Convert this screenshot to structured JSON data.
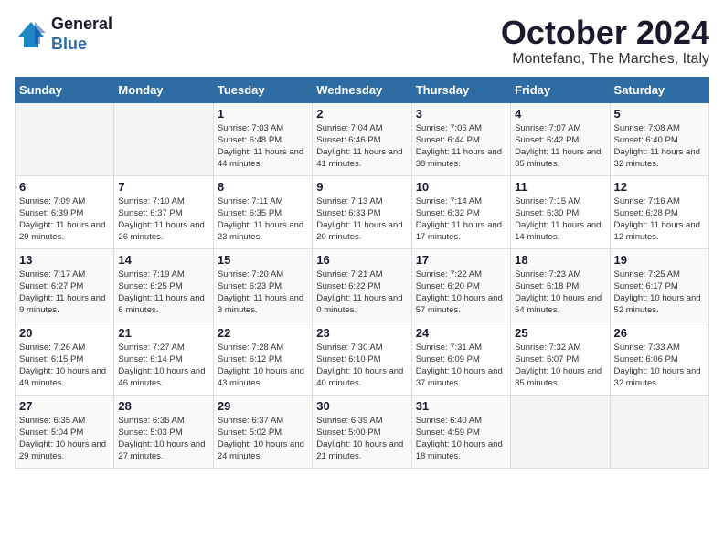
{
  "header": {
    "logo_line1": "General",
    "logo_line2": "Blue",
    "title": "October 2024",
    "subtitle": "Montefano, The Marches, Italy"
  },
  "weekdays": [
    "Sunday",
    "Monday",
    "Tuesday",
    "Wednesday",
    "Thursday",
    "Friday",
    "Saturday"
  ],
  "weeks": [
    [
      {
        "day": "",
        "info": ""
      },
      {
        "day": "",
        "info": ""
      },
      {
        "day": "1",
        "info": "Sunrise: 7:03 AM\nSunset: 6:48 PM\nDaylight: 11 hours and 44 minutes."
      },
      {
        "day": "2",
        "info": "Sunrise: 7:04 AM\nSunset: 6:46 PM\nDaylight: 11 hours and 41 minutes."
      },
      {
        "day": "3",
        "info": "Sunrise: 7:06 AM\nSunset: 6:44 PM\nDaylight: 11 hours and 38 minutes."
      },
      {
        "day": "4",
        "info": "Sunrise: 7:07 AM\nSunset: 6:42 PM\nDaylight: 11 hours and 35 minutes."
      },
      {
        "day": "5",
        "info": "Sunrise: 7:08 AM\nSunset: 6:40 PM\nDaylight: 11 hours and 32 minutes."
      }
    ],
    [
      {
        "day": "6",
        "info": "Sunrise: 7:09 AM\nSunset: 6:39 PM\nDaylight: 11 hours and 29 minutes."
      },
      {
        "day": "7",
        "info": "Sunrise: 7:10 AM\nSunset: 6:37 PM\nDaylight: 11 hours and 26 minutes."
      },
      {
        "day": "8",
        "info": "Sunrise: 7:11 AM\nSunset: 6:35 PM\nDaylight: 11 hours and 23 minutes."
      },
      {
        "day": "9",
        "info": "Sunrise: 7:13 AM\nSunset: 6:33 PM\nDaylight: 11 hours and 20 minutes."
      },
      {
        "day": "10",
        "info": "Sunrise: 7:14 AM\nSunset: 6:32 PM\nDaylight: 11 hours and 17 minutes."
      },
      {
        "day": "11",
        "info": "Sunrise: 7:15 AM\nSunset: 6:30 PM\nDaylight: 11 hours and 14 minutes."
      },
      {
        "day": "12",
        "info": "Sunrise: 7:16 AM\nSunset: 6:28 PM\nDaylight: 11 hours and 12 minutes."
      }
    ],
    [
      {
        "day": "13",
        "info": "Sunrise: 7:17 AM\nSunset: 6:27 PM\nDaylight: 11 hours and 9 minutes."
      },
      {
        "day": "14",
        "info": "Sunrise: 7:19 AM\nSunset: 6:25 PM\nDaylight: 11 hours and 6 minutes."
      },
      {
        "day": "15",
        "info": "Sunrise: 7:20 AM\nSunset: 6:23 PM\nDaylight: 11 hours and 3 minutes."
      },
      {
        "day": "16",
        "info": "Sunrise: 7:21 AM\nSunset: 6:22 PM\nDaylight: 11 hours and 0 minutes."
      },
      {
        "day": "17",
        "info": "Sunrise: 7:22 AM\nSunset: 6:20 PM\nDaylight: 10 hours and 57 minutes."
      },
      {
        "day": "18",
        "info": "Sunrise: 7:23 AM\nSunset: 6:18 PM\nDaylight: 10 hours and 54 minutes."
      },
      {
        "day": "19",
        "info": "Sunrise: 7:25 AM\nSunset: 6:17 PM\nDaylight: 10 hours and 52 minutes."
      }
    ],
    [
      {
        "day": "20",
        "info": "Sunrise: 7:26 AM\nSunset: 6:15 PM\nDaylight: 10 hours and 49 minutes."
      },
      {
        "day": "21",
        "info": "Sunrise: 7:27 AM\nSunset: 6:14 PM\nDaylight: 10 hours and 46 minutes."
      },
      {
        "day": "22",
        "info": "Sunrise: 7:28 AM\nSunset: 6:12 PM\nDaylight: 10 hours and 43 minutes."
      },
      {
        "day": "23",
        "info": "Sunrise: 7:30 AM\nSunset: 6:10 PM\nDaylight: 10 hours and 40 minutes."
      },
      {
        "day": "24",
        "info": "Sunrise: 7:31 AM\nSunset: 6:09 PM\nDaylight: 10 hours and 37 minutes."
      },
      {
        "day": "25",
        "info": "Sunrise: 7:32 AM\nSunset: 6:07 PM\nDaylight: 10 hours and 35 minutes."
      },
      {
        "day": "26",
        "info": "Sunrise: 7:33 AM\nSunset: 6:06 PM\nDaylight: 10 hours and 32 minutes."
      }
    ],
    [
      {
        "day": "27",
        "info": "Sunrise: 6:35 AM\nSunset: 5:04 PM\nDaylight: 10 hours and 29 minutes."
      },
      {
        "day": "28",
        "info": "Sunrise: 6:36 AM\nSunset: 5:03 PM\nDaylight: 10 hours and 27 minutes."
      },
      {
        "day": "29",
        "info": "Sunrise: 6:37 AM\nSunset: 5:02 PM\nDaylight: 10 hours and 24 minutes."
      },
      {
        "day": "30",
        "info": "Sunrise: 6:39 AM\nSunset: 5:00 PM\nDaylight: 10 hours and 21 minutes."
      },
      {
        "day": "31",
        "info": "Sunrise: 6:40 AM\nSunset: 4:59 PM\nDaylight: 10 hours and 18 minutes."
      },
      {
        "day": "",
        "info": ""
      },
      {
        "day": "",
        "info": ""
      }
    ]
  ]
}
